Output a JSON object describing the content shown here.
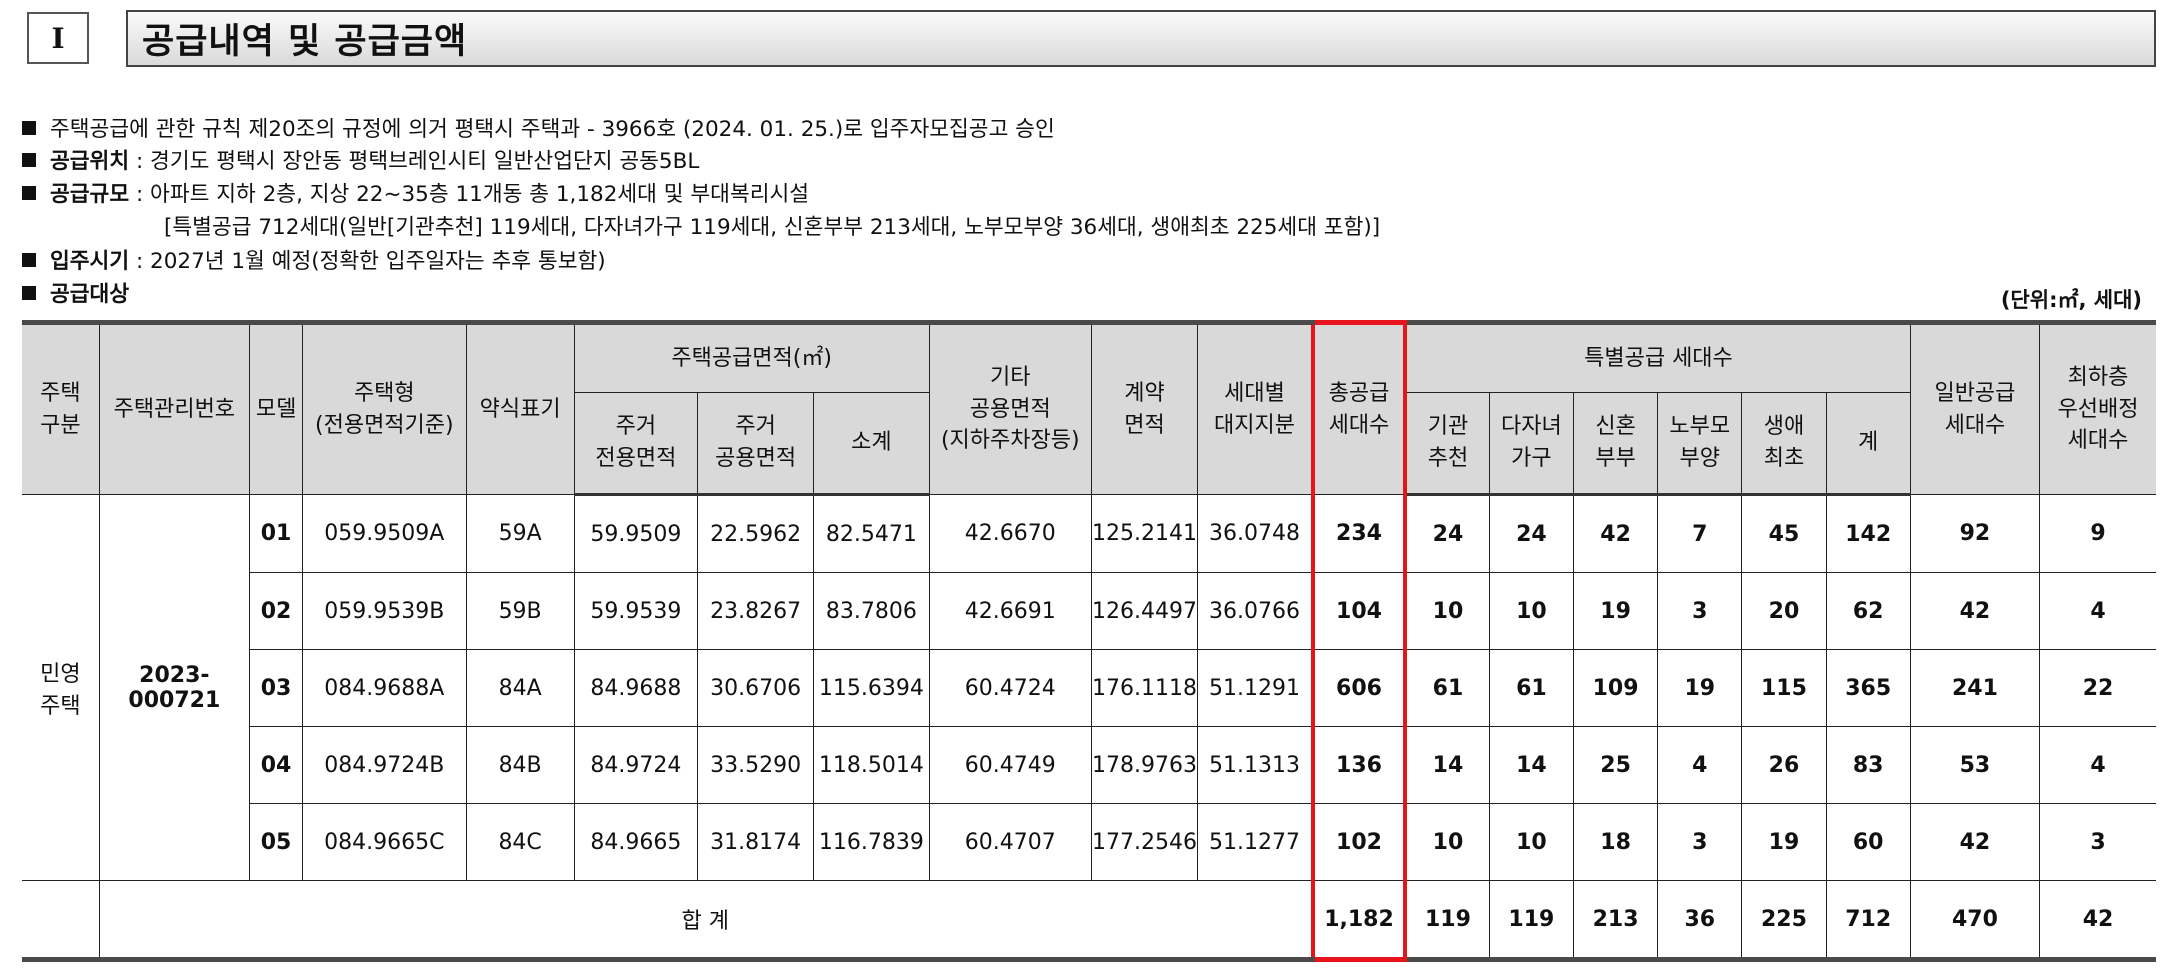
{
  "section": {
    "number": "I",
    "title": "공급내역 및 공급금액"
  },
  "info": {
    "line1": "주택공급에 관한 규칙 제20조의 규정에 의거 평택시 주택과 - 3966호 (2024. 01. 25.)로 입주자모집공고 승인",
    "location_label": "공급위치",
    "location_value": " : 경기도 평택시 장안동 평택브레인시티 일반산업단지 공동5BL",
    "scale_label": "공급규모",
    "scale_value": " : 아파트 지하 2층, 지상 22~35층 11개동 총 1,182세대 및 부대복리시설",
    "scale_detail": "[특별공급 712세대(일반[기관추천] 119세대, 다자녀가구 119세대, 신혼부부 213세대, 노부모부양 36세대, 생애최초 225세대 포함)]",
    "movein_label": "입주시기",
    "movein_value": " : 2027년 1월 예정(정확한 입주일자는 추후 통보함)",
    "target_label": "공급대상",
    "unit": "(단위:㎡, 세대)"
  },
  "table": {
    "headers": {
      "type": "주택\n구분",
      "mgmt_no": "주택관리번호",
      "model": "모델",
      "housing_type": "주택형\n(전용면적기준)",
      "abbr": "약식표기",
      "area_group": "주택공급면적(㎡)",
      "exclusive": "주거\n전용면적",
      "common": "주거\n공용면적",
      "subtotal": "소계",
      "other_common": "기타\n공용면적\n(지하주차장등)",
      "contract": "계약\n면적",
      "land_share": "세대별\n대지지분",
      "total_supply": "총공급\n세대수",
      "special_group": "특별공급 세대수",
      "institution": "기관\n추천",
      "multi_child": "다자녀\n가구",
      "newlywed": "신혼\n부부",
      "elderly": "노부모\n부양",
      "first_life": "생애\n최초",
      "special_sum": "계",
      "general": "일반공급\n세대수",
      "lowest_floor": "최하층\n우선배정\n세대수"
    },
    "housing_category": "민영\n주택",
    "management_number": "2023-000721",
    "rows": [
      {
        "model": "01",
        "type": "059.9509A",
        "abbr": "59A",
        "exclusive": "59.9509",
        "common": "22.5962",
        "subtotal": "82.5471",
        "other": "42.6670",
        "contract": "125.2141",
        "land": "36.0748",
        "total": "234",
        "inst": "24",
        "multi": "24",
        "newly": "42",
        "elder": "7",
        "first": "45",
        "sum": "142",
        "general": "92",
        "lowest": "9"
      },
      {
        "model": "02",
        "type": "059.9539B",
        "abbr": "59B",
        "exclusive": "59.9539",
        "common": "23.8267",
        "subtotal": "83.7806",
        "other": "42.6691",
        "contract": "126.4497",
        "land": "36.0766",
        "total": "104",
        "inst": "10",
        "multi": "10",
        "newly": "19",
        "elder": "3",
        "first": "20",
        "sum": "62",
        "general": "42",
        "lowest": "4"
      },
      {
        "model": "03",
        "type": "084.9688A",
        "abbr": "84A",
        "exclusive": "84.9688",
        "common": "30.6706",
        "subtotal": "115.6394",
        "other": "60.4724",
        "contract": "176.1118",
        "land": "51.1291",
        "total": "606",
        "inst": "61",
        "multi": "61",
        "newly": "109",
        "elder": "19",
        "first": "115",
        "sum": "365",
        "general": "241",
        "lowest": "22"
      },
      {
        "model": "04",
        "type": "084.9724B",
        "abbr": "84B",
        "exclusive": "84.9724",
        "common": "33.5290",
        "subtotal": "118.5014",
        "other": "60.4749",
        "contract": "178.9763",
        "land": "51.1313",
        "total": "136",
        "inst": "14",
        "multi": "14",
        "newly": "25",
        "elder": "4",
        "first": "26",
        "sum": "83",
        "general": "53",
        "lowest": "4"
      },
      {
        "model": "05",
        "type": "084.9665C",
        "abbr": "84C",
        "exclusive": "84.9665",
        "common": "31.8174",
        "subtotal": "116.7839",
        "other": "60.4707",
        "contract": "177.2546",
        "land": "51.1277",
        "total": "102",
        "inst": "10",
        "multi": "10",
        "newly": "18",
        "elder": "3",
        "first": "19",
        "sum": "60",
        "general": "42",
        "lowest": "3"
      }
    ],
    "total_row": {
      "label": "합 계",
      "total": "1,182",
      "inst": "119",
      "multi": "119",
      "newly": "213",
      "elder": "36",
      "first": "225",
      "sum": "712",
      "general": "470",
      "lowest": "42"
    }
  },
  "colors": {
    "header_bg": "#d9d9d9",
    "highlight_border": "#e8141c"
  }
}
